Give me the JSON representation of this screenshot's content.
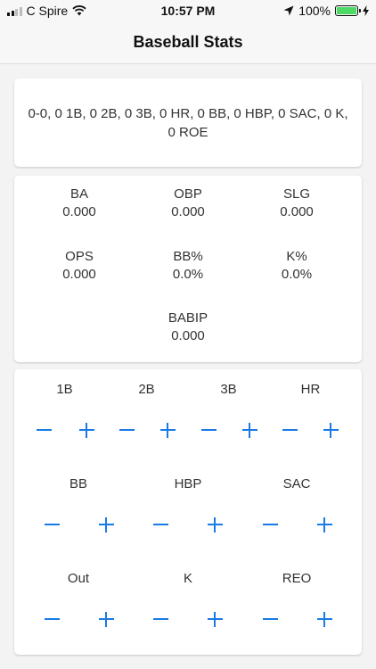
{
  "status_bar": {
    "carrier": "C Spire",
    "time": "10:57 PM",
    "battery": "100%"
  },
  "nav": {
    "title": "Baseball Stats"
  },
  "summary": {
    "text": "0-0, 0 1B, 0 2B, 0 3B, 0 HR, 0 BB, 0 HBP, 0 SAC, 0 K, 0 ROE"
  },
  "stats": [
    {
      "label": "BA",
      "value": "0.000"
    },
    {
      "label": "OBP",
      "value": "0.000"
    },
    {
      "label": "SLG",
      "value": "0.000"
    },
    {
      "label": "OPS",
      "value": "0.000"
    },
    {
      "label": "BB%",
      "value": "0.0%"
    },
    {
      "label": "K%",
      "value": "0.0%"
    },
    {
      "label": "BABIP",
      "value": "0.000"
    }
  ],
  "controls": {
    "row1": [
      "1B",
      "2B",
      "3B",
      "HR"
    ],
    "row2": [
      "BB",
      "HBP",
      "SAC"
    ],
    "row3": [
      "Out",
      "K",
      "REO"
    ],
    "minus_icon": "minus-icon",
    "plus_icon": "plus-icon",
    "accent_color": "#1a7be6"
  },
  "colors": {
    "battery_fill": "#4cd964",
    "background": "#f3f3f3"
  }
}
